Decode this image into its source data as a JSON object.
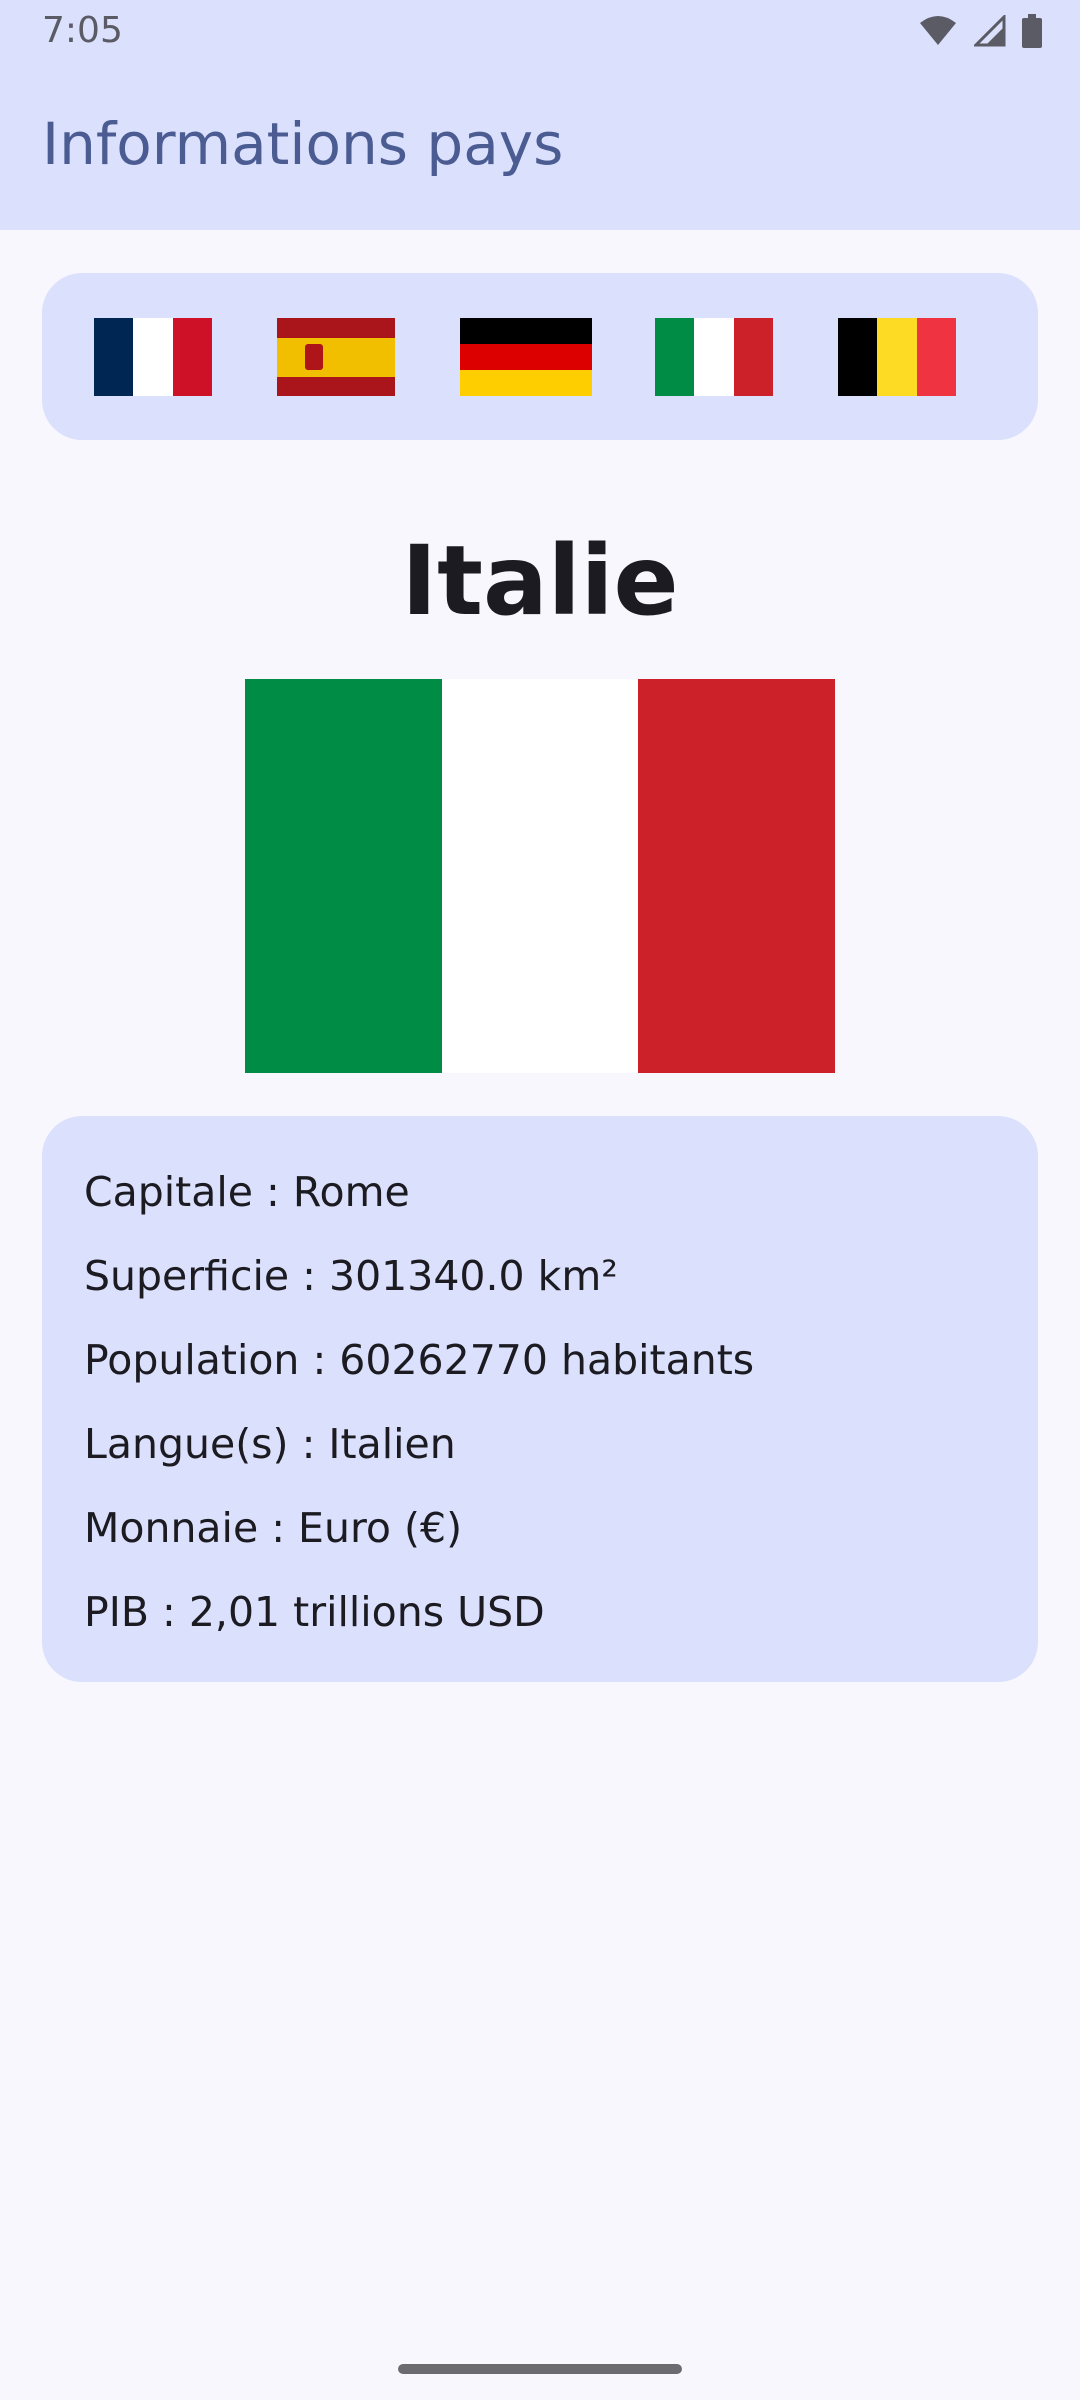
{
  "status_bar": {
    "time": "7:05",
    "icons": [
      "wifi-icon",
      "signal-icon",
      "battery-icon"
    ]
  },
  "app_bar": {
    "title": "Informations pays"
  },
  "flag_selector": [
    {
      "country": "France",
      "icon": "france-flag-icon",
      "colors": [
        "#002654",
        "#ffffff",
        "#ce1126"
      ]
    },
    {
      "country": "Espagne",
      "icon": "spain-flag-icon",
      "colors": [
        "#aa151b",
        "#f1bf00",
        "#aa151b"
      ]
    },
    {
      "country": "Allemagne",
      "icon": "germany-flag-icon",
      "colors": [
        "#000000",
        "#dd0000",
        "#ffce00"
      ]
    },
    {
      "country": "Italie",
      "icon": "italy-flag-icon",
      "colors": [
        "#008c45",
        "#ffffff",
        "#cd212a"
      ]
    },
    {
      "country": "Belgique",
      "icon": "belgium-flag-icon",
      "colors": [
        "#000000",
        "#fdda24",
        "#ef3340"
      ]
    }
  ],
  "selected_country": {
    "name": "Italie",
    "flag_colors": [
      "#008c45",
      "#ffffff",
      "#cd212a"
    ]
  },
  "details": {
    "capital": "Capitale : Rome",
    "area": "Superficie : 301340.0 km²",
    "population": "Population : 60262770 habitants",
    "languages": "Langue(s) : Italien",
    "currency": "Monnaie : Euro (€)",
    "gdp": "PIB : 2,01 trillions USD"
  },
  "theme": {
    "surface": "#dbe0fc",
    "background": "#f8f7fe",
    "title_color": "#4b5c92"
  }
}
